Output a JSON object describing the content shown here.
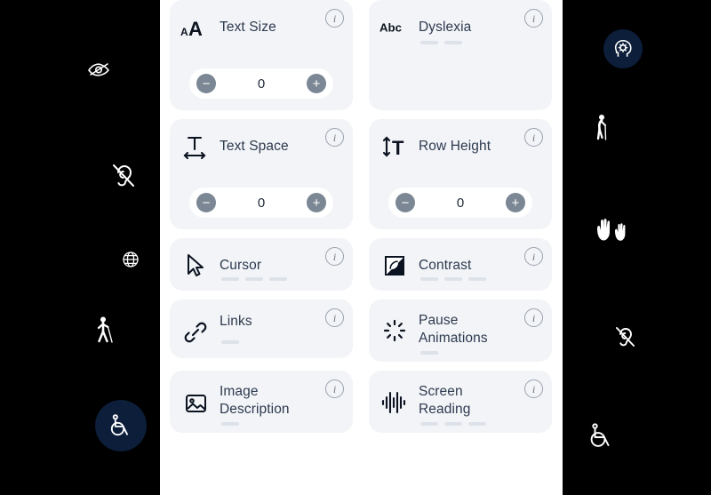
{
  "theme": {
    "background": "#000000",
    "panel_background": "#ffffff",
    "card_background": "#f2f4f7",
    "title_color": "#2e3a4f",
    "accent_navy": "#0c1e3a",
    "stepper_button": "#7b8794",
    "dash_color": "#dde2ea"
  },
  "info_glyph": "i",
  "cards": [
    {
      "id": "text-size",
      "label": "Text Size",
      "icon": "text-size-icon",
      "icon_text": "A A",
      "info": "i",
      "has_stepper": true,
      "value": "0",
      "minus": "−",
      "plus": "+",
      "dashes": 0
    },
    {
      "id": "dyslexia",
      "label": "Dyslexia",
      "icon": "abc-icon",
      "icon_text": "Abc",
      "info": "i",
      "has_stepper": false,
      "dashes": 2
    },
    {
      "id": "text-space",
      "label": "Text Space",
      "icon": "text-space-icon",
      "info": "i",
      "has_stepper": true,
      "value": "0",
      "minus": "−",
      "plus": "+",
      "dashes": 0
    },
    {
      "id": "row-height",
      "label": "Row Height",
      "icon": "row-height-icon",
      "info": "i",
      "has_stepper": true,
      "value": "0",
      "minus": "−",
      "plus": "+",
      "dashes": 0
    },
    {
      "id": "cursor",
      "label": "Cursor",
      "icon": "cursor-icon",
      "info": "i",
      "has_stepper": false,
      "dashes": 3
    },
    {
      "id": "contrast",
      "label": "Contrast",
      "icon": "contrast-icon",
      "info": "i",
      "has_stepper": false,
      "dashes": 3
    },
    {
      "id": "links",
      "label": "Links",
      "icon": "link-icon",
      "info": "i",
      "has_stepper": false,
      "dashes": 1
    },
    {
      "id": "pause-animations",
      "label": "Pause Animations",
      "icon": "spinner-icon",
      "info": "i",
      "has_stepper": false,
      "dashes": 1
    },
    {
      "id": "image-description",
      "label": "Image Description",
      "icon": "image-icon",
      "info": "i",
      "has_stepper": false,
      "dashes": 1
    },
    {
      "id": "screen-reading",
      "label": "Screen Reading",
      "icon": "waveform-icon",
      "info": "i",
      "has_stepper": false,
      "dashes": 3
    }
  ],
  "floating_icons": [
    {
      "id": "eye-off",
      "name": "eye-off-icon"
    },
    {
      "id": "ear-off-left",
      "name": "ear-off-icon"
    },
    {
      "id": "globe",
      "name": "globe-icon"
    },
    {
      "id": "blind-cane",
      "name": "blind-person-cane-icon"
    },
    {
      "id": "elderly",
      "name": "elderly-person-cane-icon"
    },
    {
      "id": "sign-language",
      "name": "sign-language-hands-icon"
    },
    {
      "id": "ear-off-right",
      "name": "ear-off-icon"
    },
    {
      "id": "wheelchair-outline",
      "name": "wheelchair-icon"
    }
  ],
  "buttons": [
    {
      "id": "accessibility-fab",
      "name": "wheelchair-accessibility-button"
    },
    {
      "id": "cognitive-fab",
      "name": "cognitive-head-gear-button"
    }
  ]
}
